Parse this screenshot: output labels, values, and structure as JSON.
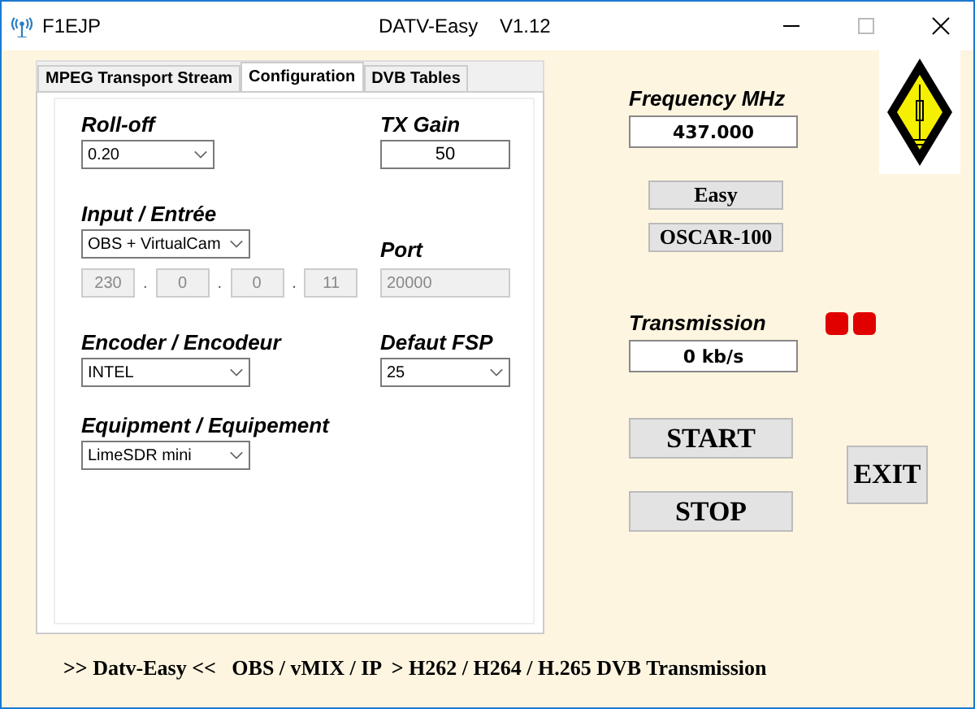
{
  "window": {
    "title_left": "F1EJP",
    "title": "DATV-Easy    V1.12"
  },
  "tabs": [
    {
      "label": "MPEG Transport Stream",
      "selected": false
    },
    {
      "label": "Configuration",
      "selected": true
    },
    {
      "label": "DVB Tables",
      "selected": false
    }
  ],
  "config": {
    "rolloff": {
      "label": "Roll-off",
      "value": "0.20"
    },
    "tx_gain": {
      "label": "TX Gain",
      "value": "50"
    },
    "input": {
      "label": "Input / Entrée",
      "value": "OBS + VirtualCam"
    },
    "port": {
      "label": "Port",
      "value": "20000",
      "disabled": true
    },
    "ip": {
      "parts": [
        "230",
        "0",
        "0",
        "11"
      ],
      "separator": ".",
      "disabled": true
    },
    "encoder": {
      "label": "Encoder / Encodeur",
      "value": "INTEL"
    },
    "fps": {
      "label": "Defaut FSP",
      "value": "25"
    },
    "equipment": {
      "label": "Equipment / Equipement",
      "value": "LimeSDR mini"
    }
  },
  "frequency": {
    "label": "Frequency MHz",
    "value": "437.000"
  },
  "mode_buttons": [
    "Easy",
    "OSCAR-100"
  ],
  "transmission": {
    "label": "Transmission",
    "value": "0 kb/s",
    "leds": [
      {
        "color": "#e00000"
      },
      {
        "color": "#e00000"
      }
    ]
  },
  "buttons": {
    "start": "START",
    "stop": "STOP",
    "exit": "EXIT"
  },
  "status_bar": ">> Datv-Easy <<   OBS / vMIX / IP  > H262 / H264 / H.265 DVB Transmission"
}
